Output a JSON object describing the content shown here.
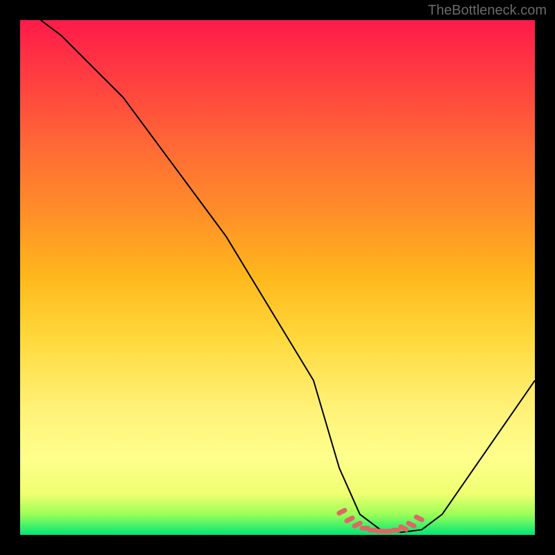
{
  "watermark": "TheBottleneck.com",
  "chart_data": {
    "type": "line",
    "title": "",
    "xlabel": "",
    "ylabel": "",
    "xlim": [
      0,
      100
    ],
    "ylim": [
      0,
      100
    ],
    "series": [
      {
        "name": "curve",
        "x": [
          4,
          8,
          20,
          40,
          57,
          62,
          66,
          70,
          74,
          78,
          82,
          100
        ],
        "y": [
          100,
          97,
          85,
          58,
          30,
          13,
          4,
          1,
          0.5,
          1,
          4,
          30
        ]
      }
    ],
    "markers": {
      "name": "highlight-dashes",
      "x": [
        62.5,
        64,
        65.5,
        67,
        68.5,
        70,
        71.5,
        73,
        74.5,
        76,
        77.5
      ],
      "y": [
        4.5,
        3,
        2,
        1.3,
        0.9,
        0.7,
        0.7,
        0.9,
        1.3,
        2,
        3.2
      ]
    },
    "gradient_colors": {
      "top": "#ff1a4a",
      "bottom": "#00e676"
    }
  }
}
